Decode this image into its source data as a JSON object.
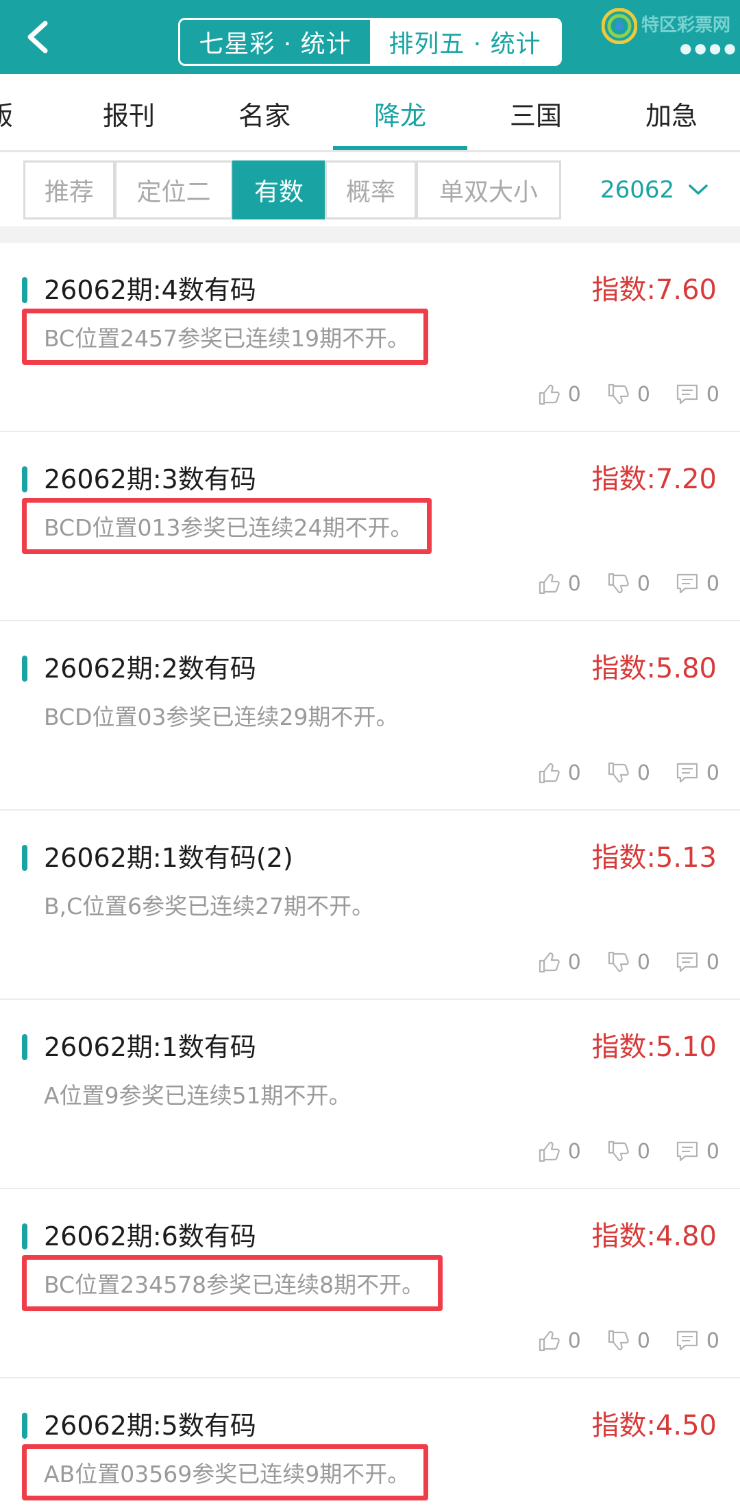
{
  "header": {
    "segments": [
      "七星彩 · 统计",
      "排列五 · 统计"
    ],
    "watermark_text": "特区彩票网",
    "watermark_sub": "●●●●"
  },
  "tabs": [
    "版",
    "报刊",
    "名家",
    "降龙",
    "三国",
    "加急"
  ],
  "active_tab": "降龙",
  "filters": [
    "推荐",
    "定位二",
    "有数",
    "概率",
    "单双大小"
  ],
  "active_filter": "有数",
  "issue_select": "26062",
  "colors": {
    "accent": "#1aa3a3",
    "index_red": "#d83a3a",
    "highlight_box": "#ef3e4a"
  },
  "items": [
    {
      "title": "26062期:4数有码",
      "index": "指数:7.60",
      "desc": "BC位置2457参奖已连续19期不开。",
      "highlighted": true,
      "likes": "0",
      "dislikes": "0",
      "comments": "0"
    },
    {
      "title": "26062期:3数有码",
      "index": "指数:7.20",
      "desc": "BCD位置013参奖已连续24期不开。",
      "highlighted": true,
      "likes": "0",
      "dislikes": "0",
      "comments": "0"
    },
    {
      "title": "26062期:2数有码",
      "index": "指数:5.80",
      "desc": "BCD位置03参奖已连续29期不开。",
      "highlighted": false,
      "likes": "0",
      "dislikes": "0",
      "comments": "0"
    },
    {
      "title": "26062期:1数有码(2)",
      "index": "指数:5.13",
      "desc": "B,C位置6参奖已连续27期不开。",
      "highlighted": false,
      "likes": "0",
      "dislikes": "0",
      "comments": "0"
    },
    {
      "title": "26062期:1数有码",
      "index": "指数:5.10",
      "desc": "A位置9参奖已连续51期不开。",
      "highlighted": false,
      "likes": "0",
      "dislikes": "0",
      "comments": "0"
    },
    {
      "title": "26062期:6数有码",
      "index": "指数:4.80",
      "desc": "BC位置234578参奖已连续8期不开。",
      "highlighted": true,
      "likes": "0",
      "dislikes": "0",
      "comments": "0"
    },
    {
      "title": "26062期:5数有码",
      "index": "指数:4.50",
      "desc": "AB位置03569参奖已连续9期不开。",
      "highlighted": true,
      "likes": "",
      "dislikes": "",
      "comments": ""
    }
  ]
}
